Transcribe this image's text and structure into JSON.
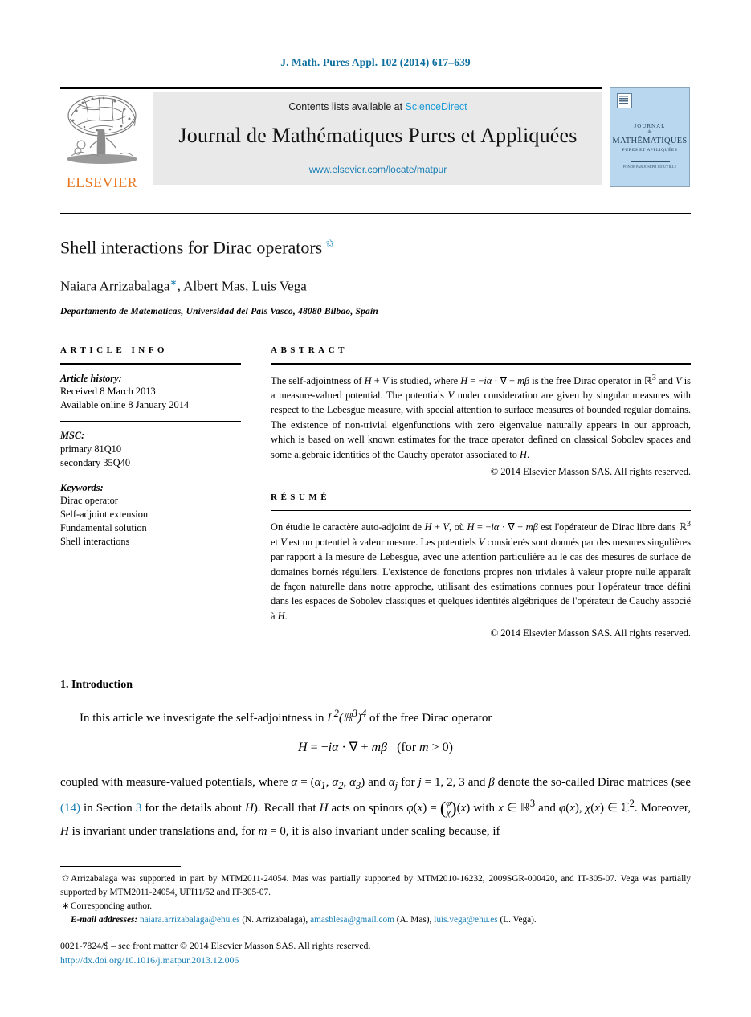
{
  "running_head": "J. Math. Pures Appl. 102 (2014) 617–639",
  "masthead": {
    "contents_prefix": "Contents lists available at ",
    "sciencedirect": "ScienceDirect",
    "journal_title": "Journal de Mathématiques Pures et Appliquées",
    "journal_url": "www.elsevier.com/locate/matpur",
    "publisher_wordmark": "ELSEVIER",
    "cover": {
      "line1": "JOURNAL",
      "line2": "de",
      "line3": "MATHÉMATIQUES",
      "line4": "PURES ET APPLIQUÉES",
      "line5": "FONDÉ PAR JOSEPH LIOUVILLE"
    }
  },
  "article": {
    "title": "Shell interactions for Dirac operators",
    "title_footnote_mark": "✩",
    "authors": "Naiara Arrizabalaga",
    "authors_corr_mark": "∗",
    "authors_rest": ", Albert Mas, Luis Vega",
    "affiliation": "Departamento de Matemáticas, Universidad del País Vasco, 48080 Bilbao, Spain"
  },
  "article_info": {
    "heading": "ARTICLE INFO",
    "history_label": "Article history:",
    "history": [
      "Received 8 March 2013",
      "Available online 8 January 2014"
    ],
    "msc_label": "MSC:",
    "msc": [
      "primary 81Q10",
      "secondary 35Q40"
    ],
    "keywords_label": "Keywords:",
    "keywords": [
      "Dirac operator",
      "Self-adjoint extension",
      "Fundamental solution",
      "Shell interactions"
    ]
  },
  "abstract": {
    "heading": "ABSTRACT",
    "text": "The self-adjointness of H + V is studied, where H = −iα · ∇ + mβ is the free Dirac operator in ℝ3 and V is a measure-valued potential. The potentials V under consideration are given by singular measures with respect to the Lebesgue measure, with special attention to surface measures of bounded regular domains. The existence of non-trivial eigenfunctions with zero eigenvalue naturally appears in our approach, which is based on well known estimates for the trace operator defined on classical Sobolev spaces and some algebraic identities of the Cauchy operator associated to H.",
    "copyright": "© 2014 Elsevier Masson SAS. All rights reserved."
  },
  "resume": {
    "heading": "RÉSUMÉ",
    "text": "On étudie le caractère auto-adjoint de H + V, où H = −iα · ∇ + mβ est l'opérateur de Dirac libre dans ℝ3 et V est un potentiel à valeur mesure. Les potentiels V considerés sont donnés par des mesures singulières par rapport à la mesure de Lebesgue, avec une attention particulière au le cas des mesures de surface de domaines bornés réguliers. L'existence de fonctions propres non triviales à valeur propre nulle apparaît de façon naturelle dans notre approche, utilisant des estimations connues pour l'opérateur trace défini dans les espaces de Sobolev classiques et quelques identités algébriques de l'opérateur de Cauchy associé à H.",
    "copyright": "© 2014 Elsevier Masson SAS. All rights reserved."
  },
  "body": {
    "section_title": "1. Introduction",
    "para1_a": "In this article we investigate the self-adjointness in ",
    "para1_math": "L2(ℝ3)4",
    "para1_b": " of the free Dirac operator",
    "equation": "H = −iα · ∇ + mβ   (for m > 0)",
    "para2_a": "coupled with measure-valued potentials, where α = (α",
    "para2_b": ") and α",
    "para2_c": " for j = 1, 2, 3 and β denote the so-called Dirac matrices (see ",
    "ref_14": "(14)",
    "para2_d": " in Section ",
    "ref_3": "3",
    "para2_e": " for the details about H). Recall that H acts on spinors",
    "para2_f": "φ(x) = ",
    "spinor_top": "φ",
    "spinor_bottom": "χ",
    "para2_g": "(x) with x ∈ ℝ3 and φ(x), χ(x) ∈ ℂ2. Moreover, H is invariant under translations and, for m = 0, it is also invariant under scaling because, if"
  },
  "footnotes": {
    "mark1": "✩",
    "note1": "Arrizabalaga was supported in part by MTM2011-24054. Mas was partially supported by MTM2010-16232, 2009SGR-000420, and IT-305-07. Vega was partially supported by MTM2011-24054, UFI11/52 and IT-305-07.",
    "mark2": "∗",
    "note2": "Corresponding author.",
    "email_label": "E-mail addresses:",
    "emails": [
      {
        "address": "naiara.arrizabalaga@ehu.es",
        "person": "(N. Arrizabalaga)"
      },
      {
        "address": "amasblesa@gmail.com",
        "person": "(A. Mas)"
      },
      {
        "address": "luis.vega@ehu.es",
        "person": "(L. Vega)"
      }
    ]
  },
  "imprint": {
    "line1": "0021-7824/$ – see front matter © 2014 Elsevier Masson SAS. All rights reserved.",
    "doi": "http://dx.doi.org/10.1016/j.matpur.2013.12.006"
  },
  "colors": {
    "link": "#1a7fb5",
    "header_link": "#0b6e9e",
    "sciencedirect": "#1a9bd7",
    "elsevier_orange": "#e87722",
    "cover_blue": "#b9d7ee",
    "band_gray": "#e9e9e9"
  }
}
